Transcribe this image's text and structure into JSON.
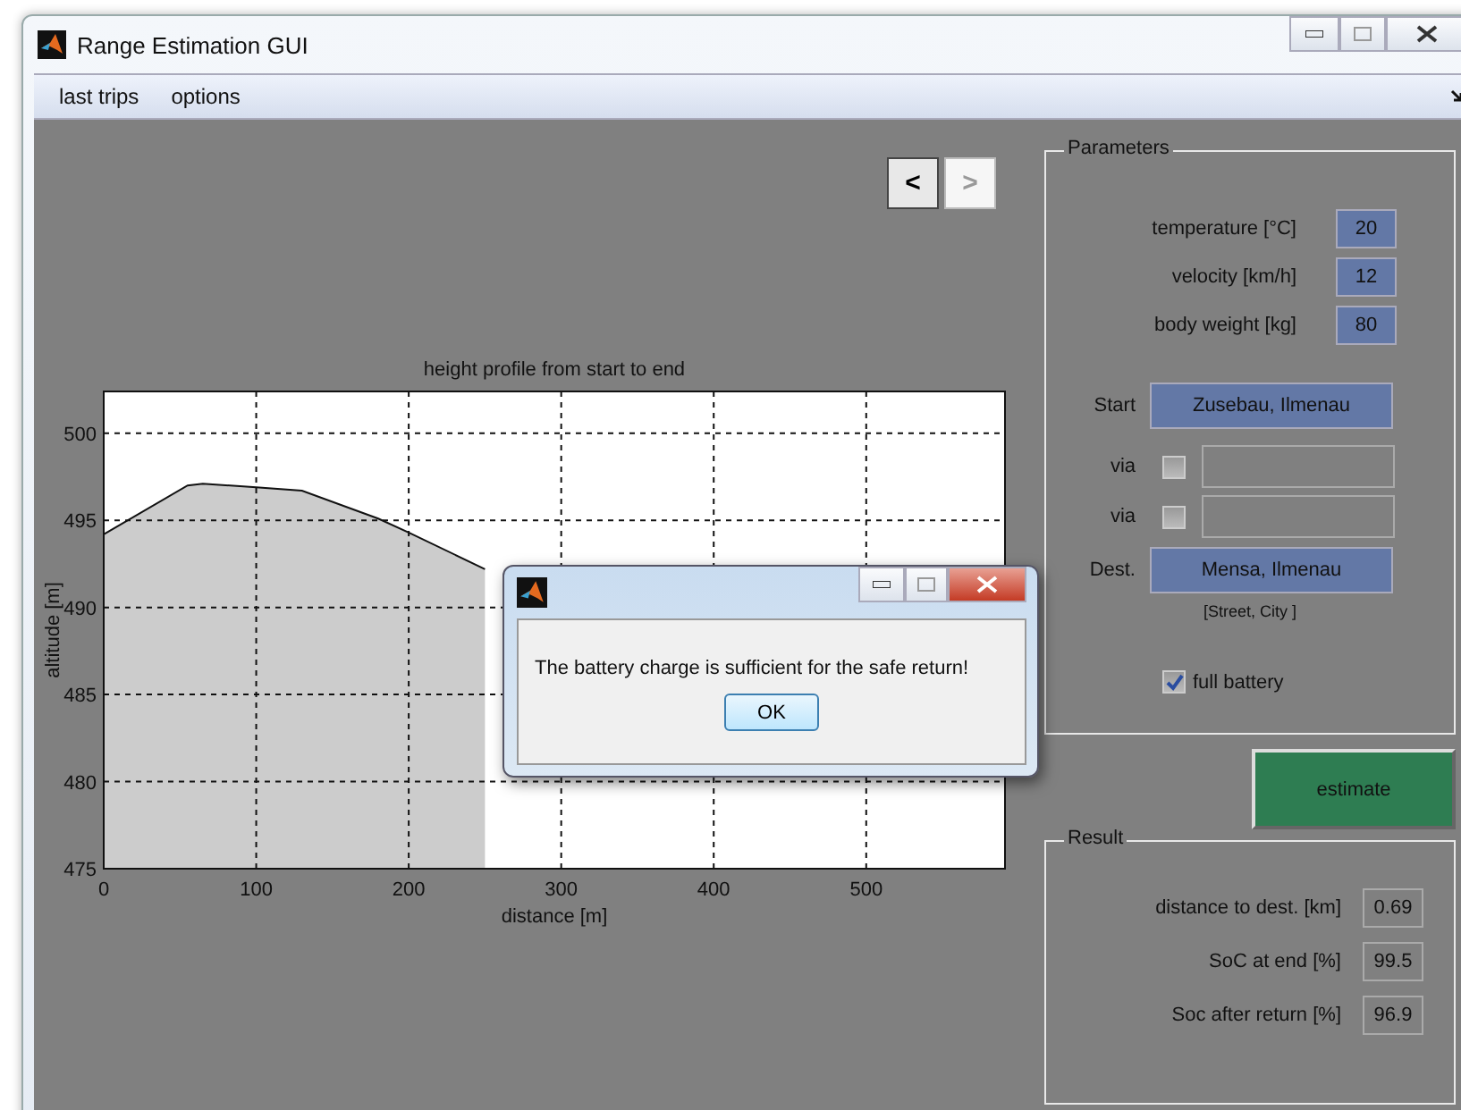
{
  "window": {
    "title": "Range Estimation GUI"
  },
  "menu": [
    "last trips",
    "options"
  ],
  "nav_buttons": [
    {
      "label": "<",
      "selected": true
    },
    {
      "label": ">",
      "selected": false
    }
  ],
  "chart": {
    "chart_data": {
      "type": "area",
      "title": "height profile from start to end",
      "xlabel": "distance [m]",
      "ylabel": "altitude [m]",
      "x": [
        0,
        55,
        65,
        100,
        130,
        180,
        200,
        250
      ],
      "series": [
        {
          "color": "#cccccc",
          "values": [
            494.2,
            497,
            497.1,
            496.9,
            496.7,
            495.1,
            494.3,
            492.2
          ]
        }
      ],
      "grid": true,
      "xlim": [
        0,
        591
      ],
      "ylim": [
        475,
        502.4
      ],
      "xticks": [
        0,
        100,
        200,
        300,
        400,
        500
      ],
      "yticks": [
        475,
        480,
        485,
        490,
        495,
        500
      ]
    }
  },
  "parameters": {
    "title": "Parameters",
    "fields": [
      {
        "label": "temperature [°C]",
        "value": "20"
      },
      {
        "label": "velocity [km/h]",
        "value": "12"
      },
      {
        "label": "body weight [kg]",
        "value": "80"
      }
    ],
    "route": [
      {
        "kind": "start",
        "label": "Start",
        "value": "Zusebau, Ilmenau"
      },
      {
        "kind": "via",
        "label": "via",
        "checked": false
      },
      {
        "kind": "via",
        "label": "via",
        "checked": false
      },
      {
        "kind": "dest",
        "label": "Dest.",
        "value": "Mensa, Ilmenau"
      }
    ],
    "hint": "[Street, City ]",
    "full_battery": {
      "label": "full battery",
      "checked": true
    }
  },
  "estimate_button": "estimate",
  "result": {
    "title": "Result",
    "rows": [
      {
        "label": "distance to dest. [km]",
        "value": "0.69"
      },
      {
        "label": "SoC at end [%]",
        "value": "99.5"
      },
      {
        "label": "Soc after return [%]",
        "value": "96.9"
      }
    ]
  },
  "dialog": {
    "message": "The battery charge is sufficient for the safe return!",
    "button": "OK"
  }
}
